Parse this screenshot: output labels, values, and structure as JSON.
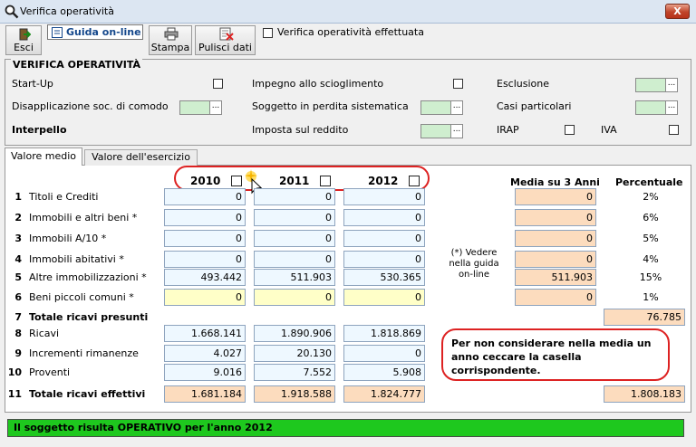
{
  "window": {
    "title": "Verifica operatività",
    "close": "X"
  },
  "toolbar": {
    "esci": "Esci",
    "guida": "Guida on-line",
    "stampa": "Stampa",
    "pulisci": "Pulisci dati",
    "verifica_label": "Verifica operatività effettuata",
    "verifica_checked": false
  },
  "frame": {
    "title": "VERIFICA OPERATIVITÀ",
    "startup": "Start-Up",
    "impegno": "Impegno allo scioglimento",
    "esclusione": "Esclusione",
    "disapplicazione": "Disapplicazione soc. di comodo",
    "soggetto": "Soggetto in perdita sistematica",
    "casi": "Casi particolari",
    "interpello": "Interpello",
    "imposta": "Imposta sul reddito",
    "irap": "IRAP",
    "iva": "IVA",
    "dots": "..."
  },
  "tabs": {
    "tab1": "Valore medio",
    "tab2": "Valore dell'esercizio"
  },
  "years": [
    "2010",
    "2011",
    "2012"
  ],
  "headers": {
    "media": "Media su 3 Anni",
    "percentuale": "Percentuale"
  },
  "rows": [
    {
      "n": "1",
      "label": "Titoli e Crediti",
      "v": [
        "0",
        "0",
        "0"
      ],
      "media": "0",
      "pct": "2%"
    },
    {
      "n": "2",
      "label": "Immobili e altri beni *",
      "v": [
        "0",
        "0",
        "0"
      ],
      "media": "0",
      "pct": "6%"
    },
    {
      "n": "3",
      "label": "Immobili A/10 *",
      "v": [
        "0",
        "0",
        "0"
      ],
      "media": "0",
      "pct": "5%"
    },
    {
      "n": "4",
      "label": "Immobili abitativi *",
      "v": [
        "0",
        "0",
        "0"
      ],
      "media": "0",
      "pct": "4%"
    },
    {
      "n": "5",
      "label": "Altre immobilizzazioni *",
      "v": [
        "493.442",
        "511.903",
        "530.365"
      ],
      "media": "511.903",
      "pct": "15%"
    },
    {
      "n": "6",
      "label": "Beni piccoli comuni *",
      "v": [
        "0",
        "0",
        "0"
      ],
      "media": "0",
      "pct": "1%"
    }
  ],
  "totale_presunti": {
    "n": "7",
    "label": "Totale ricavi presunti",
    "value": "76.785"
  },
  "rows2": [
    {
      "n": "8",
      "label": "Ricavi",
      "v": [
        "1.668.141",
        "1.890.906",
        "1.818.869"
      ]
    },
    {
      "n": "9",
      "label": "Incrementi rimanenze",
      "v": [
        "4.027",
        "20.130",
        "0"
      ]
    },
    {
      "n": "10",
      "label": "Proventi",
      "v": [
        "9.016",
        "7.552",
        "5.908"
      ]
    }
  ],
  "totale_effettivi": {
    "n": "11",
    "label": "Totale ricavi effettivi",
    "v": [
      "1.681.184",
      "1.918.588",
      "1.824.777"
    ],
    "media": "1.808.183"
  },
  "footnote": "(*) Vedere nella guida on-line",
  "note": "Per non considerare nella media un anno ceccare la casella corrispondente.",
  "status": "Il soggetto risulta OPERATIVO per l'anno 2012"
}
